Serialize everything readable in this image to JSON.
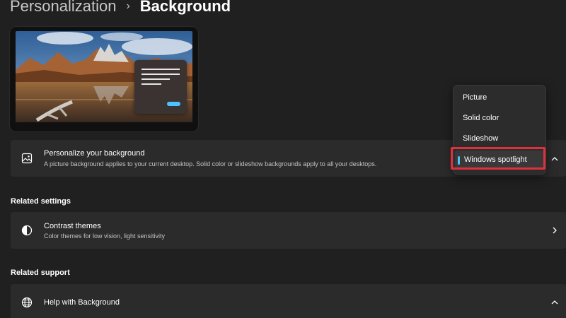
{
  "breadcrumb": {
    "parent": "Personalization",
    "separator": "›",
    "current": "Background"
  },
  "preview": {
    "accent_color": "#4cc2ff"
  },
  "personalize_card": {
    "title": "Personalize your background",
    "subtitle": "A picture background applies to your current desktop. Solid color or slideshow backgrounds apply to all your desktops.",
    "icon": "picture-icon"
  },
  "dropdown": {
    "options": [
      "Picture",
      "Solid color",
      "Slideshow",
      "Windows spotlight"
    ],
    "selected": "Windows spotlight",
    "highlight_color": "#e0303e"
  },
  "related_settings": {
    "heading": "Related settings",
    "contrast_card": {
      "title": "Contrast themes",
      "subtitle": "Color themes for low vision, light sensitivity",
      "icon": "contrast-icon"
    }
  },
  "related_support": {
    "heading": "Related support",
    "help_card": {
      "title": "Help with Background",
      "icon": "globe-icon"
    }
  }
}
